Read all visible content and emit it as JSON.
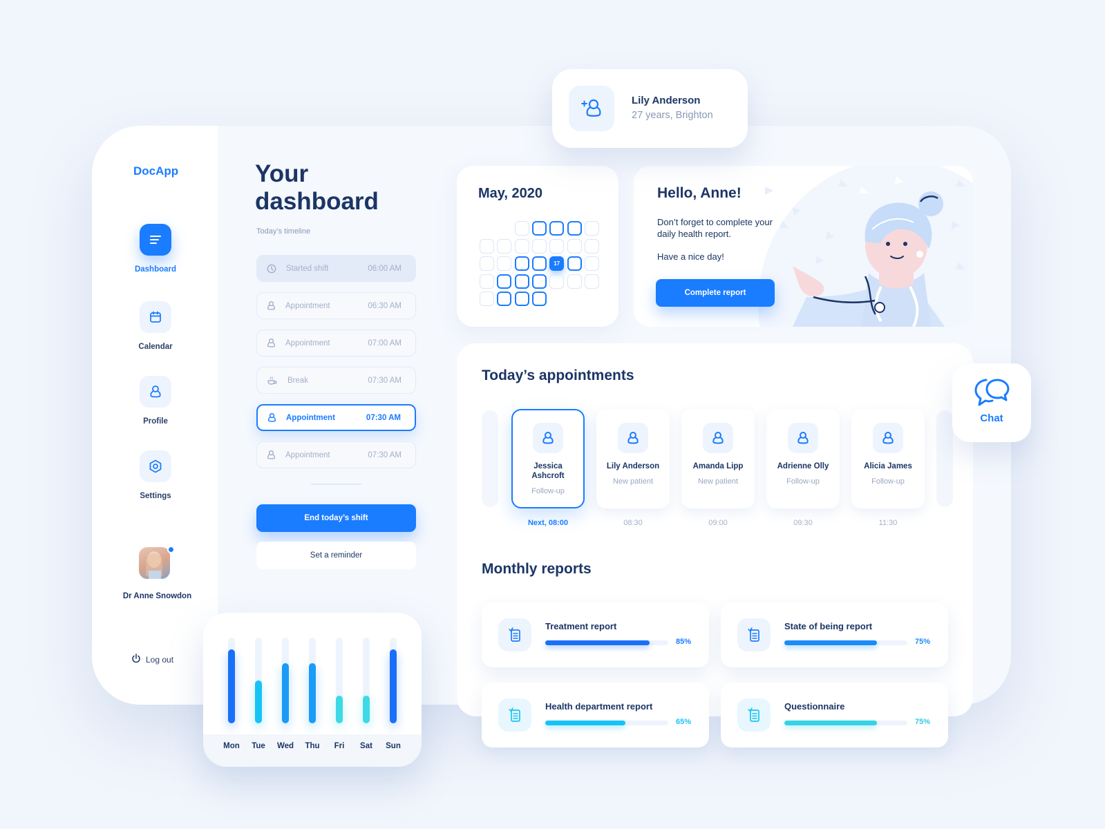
{
  "app": {
    "name": "DocApp"
  },
  "sidebar": {
    "items": [
      {
        "label": "Dashboard",
        "icon": "list-icon",
        "active": true
      },
      {
        "label": "Calendar",
        "icon": "calendar-icon",
        "active": false
      },
      {
        "label": "Profile",
        "icon": "user-icon",
        "active": false
      },
      {
        "label": "Settings",
        "icon": "settings-hexagon-icon",
        "active": false
      }
    ],
    "user": {
      "name": "Dr Anne Snowdon",
      "online": true
    },
    "logout_label": "Log out"
  },
  "dashboard": {
    "title_line1": "Your",
    "title_line2": "dashboard",
    "timeline_label": "Today’s timeline",
    "timeline": [
      {
        "label": "Started shift",
        "time": "06:00 AM",
        "icon": "clock-icon",
        "state": "past"
      },
      {
        "label": "Appointment",
        "time": "06:30 AM",
        "icon": "user-icon",
        "state": "upcoming"
      },
      {
        "label": "Appointment",
        "time": "07:00 AM",
        "icon": "user-icon",
        "state": "upcoming"
      },
      {
        "label": "Break",
        "time": "07:30 AM",
        "icon": "coffee-icon",
        "state": "upcoming"
      },
      {
        "label": "Appointment",
        "time": "07:30 AM",
        "icon": "user-icon",
        "state": "active"
      },
      {
        "label": "Appointment",
        "time": "07:30 AM",
        "icon": "user-icon",
        "state": "upcoming"
      }
    ],
    "end_shift_label": "End today’s shift",
    "reminder_label": "Set a reminder"
  },
  "calendar": {
    "title": "May, 2020",
    "today": "17"
  },
  "greeting": {
    "title": "Hello, Anne!",
    "message": "Don’t forget to complete your daily health report.",
    "sub": "Have a nice day!",
    "button_label": "Complete report"
  },
  "patient_popup": {
    "name": "Lily Anderson",
    "meta": "27 years, Brighton",
    "icon": "add-user-icon"
  },
  "appointments": {
    "title": "Today’s appointments",
    "items": [
      {
        "name": "Jessica Ashcroft",
        "type": "Follow-up",
        "time": "Next, 08:00",
        "next": true
      },
      {
        "name": "Lily Anderson",
        "type": "New patient",
        "time": "08:30",
        "next": false
      },
      {
        "name": "Amanda Lipp",
        "type": "New patient",
        "time": "09:00",
        "next": false
      },
      {
        "name": "Adrienne Olly",
        "type": "Follow-up",
        "time": "09:30",
        "next": false
      },
      {
        "name": "Alicia James",
        "type": "Follow-up",
        "time": "11:30",
        "next": false
      }
    ]
  },
  "reports": {
    "title": "Monthly reports",
    "items": [
      {
        "title": "Treatment report",
        "percent": 85,
        "label": "85%",
        "color": "#1a6ff7",
        "text_color": "#1a7cff"
      },
      {
        "title": "State of being report",
        "percent": 75,
        "label": "75%",
        "color": "#1a8cf5",
        "text_color": "#1a8cf5"
      },
      {
        "title": "Health department report",
        "percent": 65,
        "label": "65%",
        "color": "#17c3f5",
        "text_color": "#17c3f5"
      },
      {
        "title": "Questionnaire",
        "percent": 75,
        "label": "75%",
        "color": "#35d3e3",
        "text_color": "#35c9e0"
      }
    ]
  },
  "chat": {
    "label": "Chat"
  },
  "chart_data": {
    "type": "bar",
    "title": "",
    "categories": [
      "Mon",
      "Tue",
      "Wed",
      "Thu",
      "Fri",
      "Sat",
      "Sun"
    ],
    "values": [
      86,
      50,
      70,
      70,
      32,
      32,
      86
    ],
    "colors": [
      "#1a6ff7",
      "#17c3f5",
      "#1a9bf7",
      "#1a9bf7",
      "#3dd9e6",
      "#3dd9e6",
      "#1a6ff7"
    ],
    "ylim": [
      0,
      100
    ],
    "xlabel": "",
    "ylabel": "",
    "grid": false
  },
  "colors": {
    "accent": "#1a7cff",
    "text": "#1b3565",
    "muted": "#8a99b5"
  }
}
